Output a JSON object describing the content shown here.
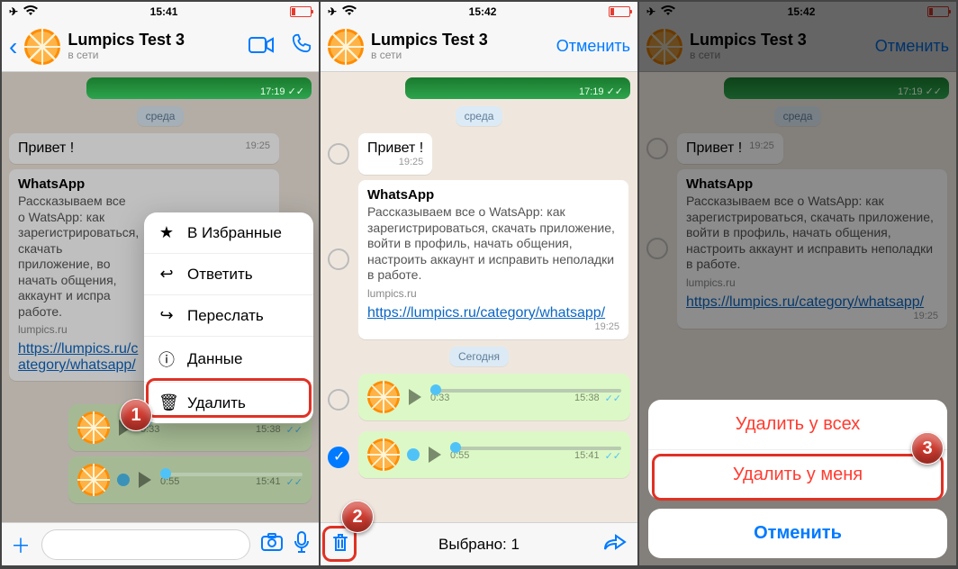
{
  "status": {
    "time1": "15:41",
    "time2": "15:42",
    "time3": "15:42"
  },
  "chat": {
    "title": "Lumpics Test 3",
    "status": "в сети"
  },
  "nav": {
    "cancel": "Отменить"
  },
  "dates": {
    "wed": "среда",
    "today": "Сегодня"
  },
  "msgs": {
    "prev_img_time": "17:19",
    "hello": "Привет !",
    "hello_time": "19:25",
    "wa_title": "WhatsApp",
    "wa_desc": "Рассказываем все о WatsApp: как зарегистрироваться, скачать приложение, войти в профиль, начать общения, настроить аккаунт и исправить неполадки в работе.",
    "wa_desc_short": "Рассказываем все о WatsApp: как зарегистрироваться, скачать приложение, во   начать общения,   аккаунт и испра   работе.",
    "wa_domain": "lumpics.ru",
    "wa_link": "https://lumpics.ru/category/whatsapp/",
    "wa_time": "19:25",
    "voice1_dur": "0:33",
    "voice1_time": "15:38",
    "voice2_dur": "0:55",
    "voice2_time": "15:41"
  },
  "context_menu": {
    "fav": "В Избранные",
    "reply": "Ответить",
    "forward": "Переслать",
    "info": "Данные",
    "delete": "Удалить"
  },
  "selection": {
    "selected_label": "Выбрано: 1"
  },
  "sheet": {
    "delete_all": "Удалить у всех",
    "delete_me": "Удалить у меня",
    "cancel": "Отменить"
  },
  "callouts": {
    "c1": "1",
    "c2": "2",
    "c3": "3"
  }
}
